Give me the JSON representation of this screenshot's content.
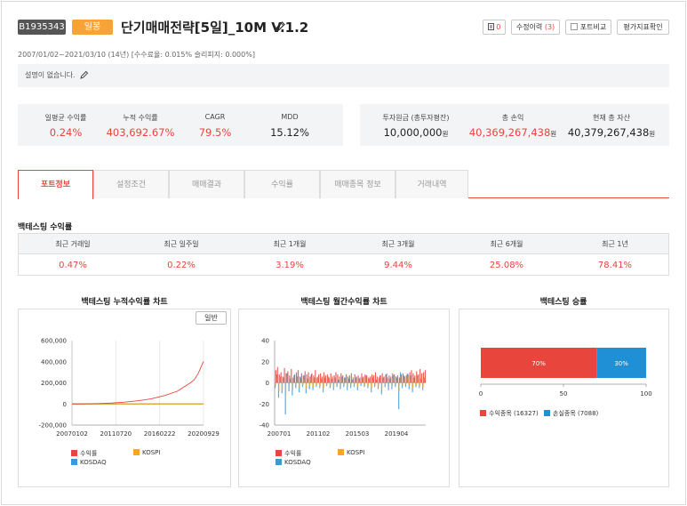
{
  "header": {
    "code": "B1935343",
    "type_badge": "일봉",
    "title": "단기매매전략[5일]_10M V.1.2",
    "btn_copy_count": "0",
    "btn_history_label": "수정이력",
    "btn_history_count": "(3)",
    "btn_compare_label": "포트비교",
    "btn_eval_label": "평가지표확인"
  },
  "period": "2007/01/02~2021/03/10 (14년) [수수료율: 0.015% 슬리피지: 0.000%]",
  "description": "설명이 없습니다.",
  "stats_left": [
    {
      "label": "일평균 수익률",
      "value": "0.24%",
      "color": "red"
    },
    {
      "label": "누적 수익률",
      "value": "403,692.67%",
      "color": "red"
    },
    {
      "label": "CAGR",
      "value": "79.5%",
      "color": "red"
    },
    {
      "label": "MDD",
      "value": "15.12%",
      "color": "dark"
    }
  ],
  "stats_right": [
    {
      "label": "투자원금 (총투자평잔)",
      "value": "10,000,000",
      "unit": "원",
      "color": "dark"
    },
    {
      "label": "총 손익",
      "value": "40,369,267,438",
      "unit": "원",
      "color": "red"
    },
    {
      "label": "현재 총 자산",
      "value": "40,379,267,438",
      "unit": "원",
      "color": "dark"
    }
  ],
  "tabs": [
    "포트정보",
    "설정조건",
    "매매결과",
    "수익률",
    "매매종목 정보",
    "거래내역"
  ],
  "active_tab": 0,
  "backtest": {
    "title": "백테스팅 수익률",
    "headers": [
      "최근 거래일",
      "최근 일주일",
      "최근 1개월",
      "최근 3개월",
      "최근 6개월",
      "최근 1년"
    ],
    "values": [
      "0.47%",
      "0.22%",
      "3.19%",
      "9.44%",
      "25.08%",
      "78.41%"
    ]
  },
  "charts": {
    "cumulative_title": "백테스팅 누적수익률 차트",
    "cumulative_button": "일반",
    "monthly_title": "백테스팅 월간수익률 차트",
    "winrate_title": "백테스팅 승률",
    "legend": [
      "수익률",
      "KOSPI",
      "KOSDAQ"
    ],
    "winrate_legend": [
      "수익종목 (16327)",
      "손실종목 (7088)"
    ]
  },
  "colors": {
    "accent": "#e8453c",
    "orange": "#f7a336",
    "blue": "#1f8fd6",
    "kospi": "#f5a623",
    "kosdaq": "#3a9ad9"
  },
  "chart_data": [
    {
      "type": "line",
      "title": "백테스팅 누적수익률 차트",
      "x_ticks": [
        "20070102",
        "20110720",
        "20160222",
        "20200929"
      ],
      "y_ticks": [
        "600,000",
        "400,000",
        "200,000",
        "0",
        "-200,000"
      ],
      "ylim": [
        -200000,
        600000
      ],
      "series": [
        {
          "name": "수익률",
          "x": [
            0,
            0.1,
            0.2,
            0.3,
            0.4,
            0.5,
            0.6,
            0.7,
            0.8,
            0.85,
            0.9,
            0.93,
            0.96,
            1.0
          ],
          "values": [
            0,
            1500,
            4000,
            9000,
            17000,
            30000,
            48000,
            78000,
            120000,
            160000,
            200000,
            230000,
            290000,
            403692
          ]
        },
        {
          "name": "KOSPI",
          "x": [
            0,
            1
          ],
          "values": [
            0,
            0
          ]
        },
        {
          "name": "KOSDAQ",
          "x": [
            0,
            1
          ],
          "values": [
            0,
            0
          ]
        }
      ],
      "legend": "bottom"
    },
    {
      "type": "bar",
      "title": "백테스팅 월간수익률 차트",
      "x_ticks": [
        "200701",
        "201102",
        "201503",
        "201904"
      ],
      "y_ticks": [
        "40",
        "20",
        "0",
        "-20",
        "-40"
      ],
      "ylim": [
        -40,
        40
      ],
      "series": [
        {
          "name": "수익률",
          "values": [
            12,
            15,
            8,
            10,
            6,
            14,
            9,
            11,
            7,
            13,
            5,
            8,
            10,
            12,
            6,
            9,
            7,
            11,
            8,
            10,
            6,
            9,
            7,
            12,
            5,
            8,
            9,
            6,
            10,
            7,
            8,
            5,
            9,
            6,
            7,
            10,
            8,
            6,
            9,
            7,
            5,
            8,
            6,
            7,
            9,
            5,
            8,
            6,
            7,
            5,
            9,
            6,
            8,
            7,
            5,
            6,
            8,
            7,
            10,
            6,
            5,
            7,
            9,
            6,
            8,
            5,
            7,
            6,
            9,
            8,
            6,
            7,
            5,
            8,
            9,
            6,
            7,
            8,
            10,
            12,
            9,
            7,
            11,
            8,
            13,
            9,
            10,
            12
          ]
        },
        {
          "name": "KOSPI",
          "values": [
            -3,
            5,
            -8,
            4,
            -6,
            3,
            -12,
            6,
            -4,
            2,
            -7,
            5,
            -3,
            4,
            -5,
            3,
            -2,
            4,
            -6,
            2,
            -3,
            5,
            -4,
            3,
            -2,
            4,
            -3,
            2,
            -5,
            3,
            -2,
            4,
            -3,
            2,
            -4,
            3,
            -2,
            1,
            -3,
            4,
            -2,
            3,
            -4,
            2,
            -3,
            1,
            -2,
            3,
            -4,
            2,
            -1,
            3,
            -2,
            4,
            -3,
            2,
            -5,
            3,
            -2,
            1,
            -3,
            4,
            -6,
            3,
            -2,
            5,
            -4,
            2,
            -3,
            4,
            -2,
            3,
            -8,
            6,
            -3,
            4,
            -2,
            5,
            -3,
            4,
            -5,
            3,
            -2,
            4,
            -3,
            2,
            -4,
            3
          ]
        },
        {
          "name": "KOSDAQ",
          "values": [
            -5,
            8,
            -14,
            6,
            -10,
            5,
            -30,
            9,
            -8,
            4,
            -12,
            7,
            -5,
            6,
            -9,
            5,
            -4,
            7,
            -10,
            4,
            -6,
            8,
            -7,
            5,
            -4,
            6,
            -5,
            4,
            -9,
            5,
            -3,
            6,
            -5,
            4,
            -7,
            5,
            -4,
            3,
            -6,
            6,
            -4,
            5,
            -7,
            4,
            -5,
            3,
            -4,
            5,
            -7,
            4,
            -3,
            5,
            -4,
            7,
            -5,
            4,
            -9,
            5,
            -4,
            3,
            -6,
            7,
            -11,
            5,
            -4,
            9,
            -7,
            4,
            -6,
            7,
            -4,
            5,
            -25,
            10,
            -5,
            7,
            -4,
            9,
            -6,
            7,
            -9,
            5,
            -4,
            7,
            -5,
            4,
            -7,
            5
          ]
        }
      ],
      "legend": "bottom"
    },
    {
      "type": "bar",
      "title": "백테스팅 승률",
      "orientation": "horizontal-stacked",
      "categories": [
        "수익종목",
        "손실종목"
      ],
      "values": [
        70,
        30
      ],
      "counts": [
        16327,
        7088
      ],
      "x_ticks": [
        "0",
        "50",
        "100"
      ],
      "xlim": [
        0,
        100
      ],
      "legend": "bottom"
    }
  ]
}
